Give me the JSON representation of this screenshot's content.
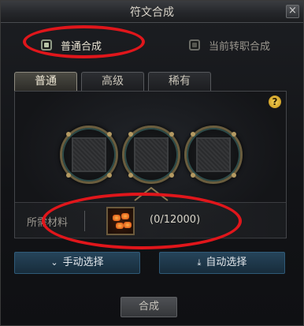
{
  "window": {
    "title": "符文合成",
    "close_glyph": "×"
  },
  "modes": {
    "normal_synthesis": "普通合成",
    "current_class_synthesis": "当前转职合成"
  },
  "tabs": [
    "普通",
    "高级",
    "稀有"
  ],
  "help_glyph": "?",
  "material": {
    "label": "所需材料",
    "count": "(0/12000)"
  },
  "buttons": {
    "manual_select": "手动选择",
    "auto_select": "自动选择",
    "compose": "合成"
  },
  "icons": {
    "manual_select": "chevron-down-icon",
    "auto_select": "download-tray-icon"
  },
  "colors": {
    "annotation_red": "#e0161b",
    "action_button_blue": "#26445a"
  }
}
